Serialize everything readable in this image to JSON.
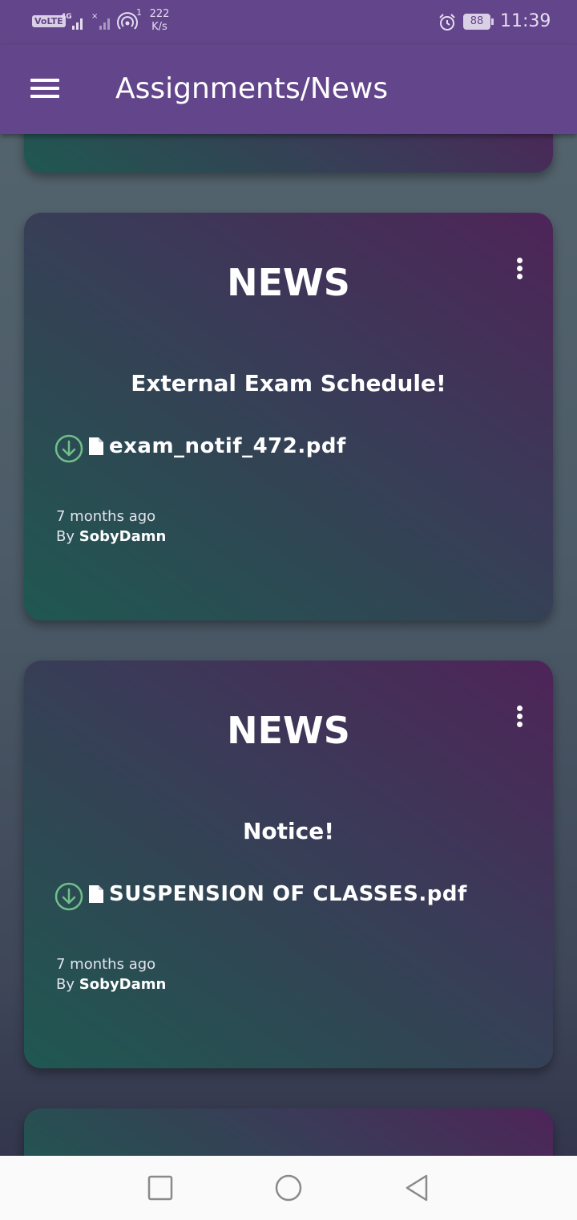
{
  "status_bar": {
    "volte": "VoLTE",
    "network": "4G",
    "sim_slot": "1",
    "speed_value": "222",
    "speed_unit": "K/s",
    "battery": "88",
    "time": "11:39"
  },
  "header": {
    "title": "Assignments/News"
  },
  "cards": [
    {
      "type": "NEWS",
      "heading": "External Exam Schedule!",
      "attachment": "exam_notif_472.pdf",
      "time": "7 months ago",
      "by_prefix": "By ",
      "author": "SobyDamn"
    },
    {
      "type": "NEWS",
      "heading": "Notice!",
      "attachment": "SUSPENSION OF CLASSES.pdf",
      "time": "7 months ago",
      "by_prefix": "By ",
      "author": "SobyDamn"
    }
  ],
  "colors": {
    "app_bar": "#62458a",
    "download_icon": "#6fbf8a",
    "card_gradient_start": "#1f5852",
    "card_gradient_end": "#4e2458"
  },
  "icons": {
    "menu": "hamburger-icon",
    "card_options": "more-vert-icon",
    "download": "download-circle-icon",
    "file": "file-icon",
    "nav_recents": "square-icon",
    "nav_home": "circle-icon",
    "nav_back": "triangle-back-icon"
  }
}
